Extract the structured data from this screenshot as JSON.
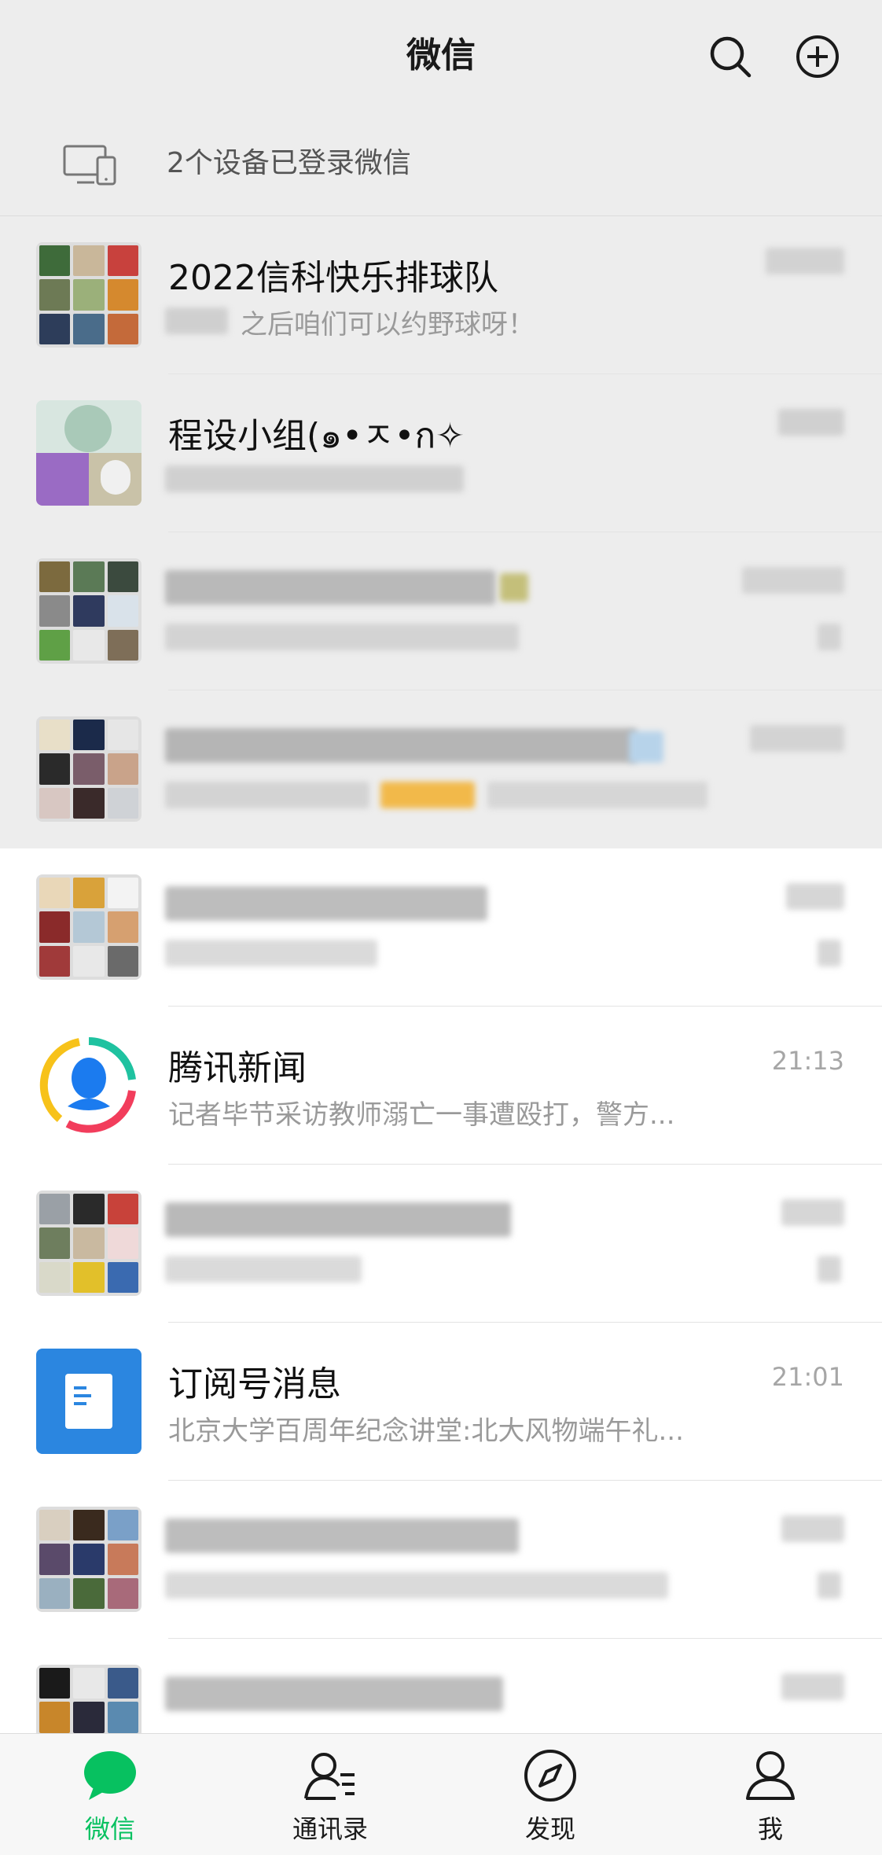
{
  "header": {
    "title": "微信",
    "search_icon": "search-icon",
    "add_icon": "plus-circle-icon"
  },
  "device_notice": {
    "text": "2个设备已登录微信",
    "icon": "desktop-phone-icon"
  },
  "chats": [
    {
      "name": "2022信科快乐排球队",
      "preview": "之后咱们可以约野球呀！",
      "time": "",
      "pinned": true
    },
    {
      "name": "程设小组(๑•ㅈ•ก✧",
      "preview": "",
      "time": "",
      "pinned": true
    },
    {
      "name": "",
      "preview": "",
      "time": "",
      "pinned": true
    },
    {
      "name": "",
      "preview": "",
      "time": "",
      "pinned": true
    },
    {
      "name": "",
      "preview": "",
      "time": "",
      "pinned": false
    },
    {
      "name": "腾讯新闻",
      "preview": "记者毕节采访教师溺亡一事遭殴打，警方...",
      "time": "21:13",
      "pinned": false
    },
    {
      "name": "",
      "preview": "",
      "time": "",
      "pinned": false
    },
    {
      "name": "订阅号消息",
      "preview": "北京大学百周年纪念讲堂:北大风物端午礼...",
      "time": "21:01",
      "pinned": false
    },
    {
      "name": "",
      "preview": "",
      "time": "",
      "pinned": false
    },
    {
      "name": "",
      "preview": "",
      "time": "",
      "pinned": false
    }
  ],
  "tabbar": {
    "tabs": [
      {
        "label": "微信",
        "icon": "chat-bubble-icon",
        "active": true
      },
      {
        "label": "通讯录",
        "icon": "contacts-icon",
        "active": false
      },
      {
        "label": "发现",
        "icon": "compass-icon",
        "active": false
      },
      {
        "label": "我",
        "icon": "person-icon",
        "active": false
      }
    ]
  },
  "colors": {
    "accent": "#07c160",
    "header_bg": "#ededed",
    "subscription_blue": "#2b86e0"
  }
}
